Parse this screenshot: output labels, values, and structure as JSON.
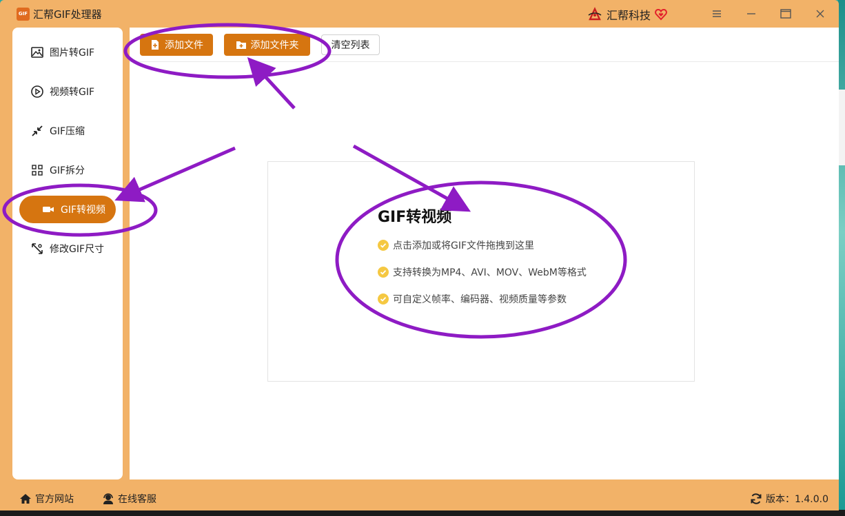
{
  "app": {
    "title": "汇帮GIF处理器",
    "logo_text": "GIF",
    "brand_name": "汇帮科技"
  },
  "window_controls": {
    "menu_icon": "menu-icon",
    "minimize_icon": "minimize-icon",
    "maximize_icon": "maximize-icon",
    "close_icon": "close-icon"
  },
  "sidebar": {
    "items": [
      {
        "label": "图片转GIF",
        "icon": "image-icon",
        "active": false
      },
      {
        "label": "视频转GIF",
        "icon": "play-icon",
        "active": false
      },
      {
        "label": "GIF压缩",
        "icon": "compress-icon",
        "active": false
      },
      {
        "label": "GIF拆分",
        "icon": "split-icon",
        "active": false
      },
      {
        "label": "GIF转视频",
        "icon": "video-icon",
        "active": true
      },
      {
        "label": "修改GIF尺寸",
        "icon": "resize-icon",
        "active": false
      }
    ]
  },
  "toolbar": {
    "add_file": "添加文件",
    "add_folder": "添加文件夹",
    "clear_list": "清空列表"
  },
  "drop_area": {
    "title": "GIF转视频",
    "features": [
      "点击添加或将GIF文件拖拽到这里",
      "支持转换为MP4、AVI、MOV、WebM等格式",
      "可自定义帧率、编码器、视频质量等参数"
    ]
  },
  "footer": {
    "website": "官方网站",
    "support": "在线客服",
    "version": "版本：1.4.0.0"
  },
  "colors": {
    "window_bg": "#f2b268",
    "accent": "#d67510",
    "annotation": "#8e1bc4",
    "check": "#f5c842"
  }
}
